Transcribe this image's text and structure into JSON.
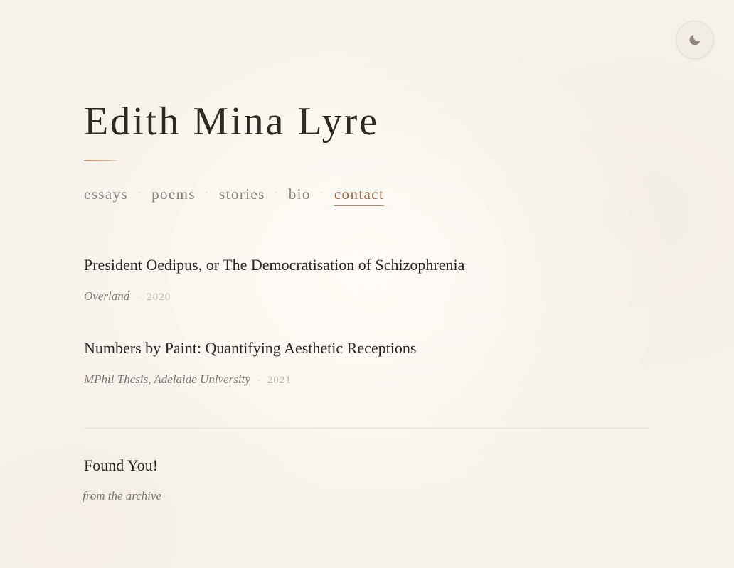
{
  "header": {
    "site_title": "Edith Mina Lyre",
    "theme_toggle_icon": "moon-icon"
  },
  "nav": {
    "items": [
      {
        "label": "essays",
        "active": false
      },
      {
        "label": "poems",
        "active": false
      },
      {
        "label": "stories",
        "active": false
      },
      {
        "label": "bio",
        "active": false
      },
      {
        "label": "contact",
        "active": true
      }
    ],
    "separator": "·"
  },
  "entries": [
    {
      "title": "President Oedipus, or The Democratisation of Schizophrenia",
      "venue": "Overland",
      "year": "2020"
    },
    {
      "title": "Numbers by Paint: Quantifying Aesthetic Receptions",
      "venue": "MPhil Thesis, Adelaide University",
      "year": "2021"
    }
  ],
  "archive": {
    "title": "Found You!",
    "subtitle": "from the archive"
  },
  "colors": {
    "accent": "#a0664b",
    "background": "#f7f3ec",
    "text": "#2b2722",
    "muted": "#8a8279"
  }
}
